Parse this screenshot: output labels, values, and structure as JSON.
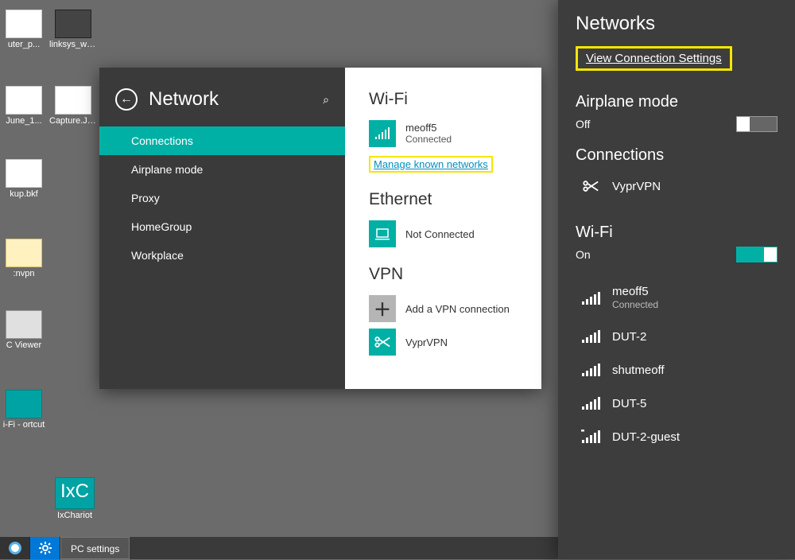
{
  "desktop": {
    "icons": [
      {
        "label": "uter_p..."
      },
      {
        "label": "linksys_wrt1..."
      },
      {
        "label": "June_1..."
      },
      {
        "label": "Capture.JPG"
      },
      {
        "label": "kup.bkf"
      },
      {
        "label": ":nvpn"
      },
      {
        "label": "C Viewer"
      },
      {
        "label": "i-Fi - ortcut"
      },
      {
        "label": "IxChariot"
      }
    ],
    "ixc_badge": "IxC"
  },
  "taskbar": {
    "app_label": "PC settings"
  },
  "settings": {
    "title": "Network",
    "menu": [
      "Connections",
      "Airplane mode",
      "Proxy",
      "HomeGroup",
      "Workplace"
    ],
    "wifi": {
      "heading": "Wi-Fi",
      "ssid": "meoff5",
      "status": "Connected",
      "manage_link": "Manage known networks"
    },
    "ethernet": {
      "heading": "Ethernet",
      "status": "Not Connected"
    },
    "vpn": {
      "heading": "VPN",
      "add_label": "Add a VPN connection",
      "entries": [
        "VyprVPN"
      ]
    }
  },
  "charms": {
    "title": "Networks",
    "view_link": "View Connection Settings",
    "airplane": {
      "heading": "Airplane mode",
      "state": "Off"
    },
    "connections": {
      "heading": "Connections",
      "items": [
        "VyprVPN"
      ]
    },
    "wifi": {
      "heading": "Wi-Fi",
      "state": "On",
      "networks": [
        {
          "ssid": "meoff5",
          "status": "Connected"
        },
        {
          "ssid": "DUT-2",
          "status": ""
        },
        {
          "ssid": "shutmeoff",
          "status": ""
        },
        {
          "ssid": "DUT-5",
          "status": ""
        },
        {
          "ssid": "DUT-2-guest",
          "status": ""
        }
      ]
    }
  },
  "icons": {
    "back_arrow": "←",
    "search": "⌕",
    "plus": "＋"
  }
}
